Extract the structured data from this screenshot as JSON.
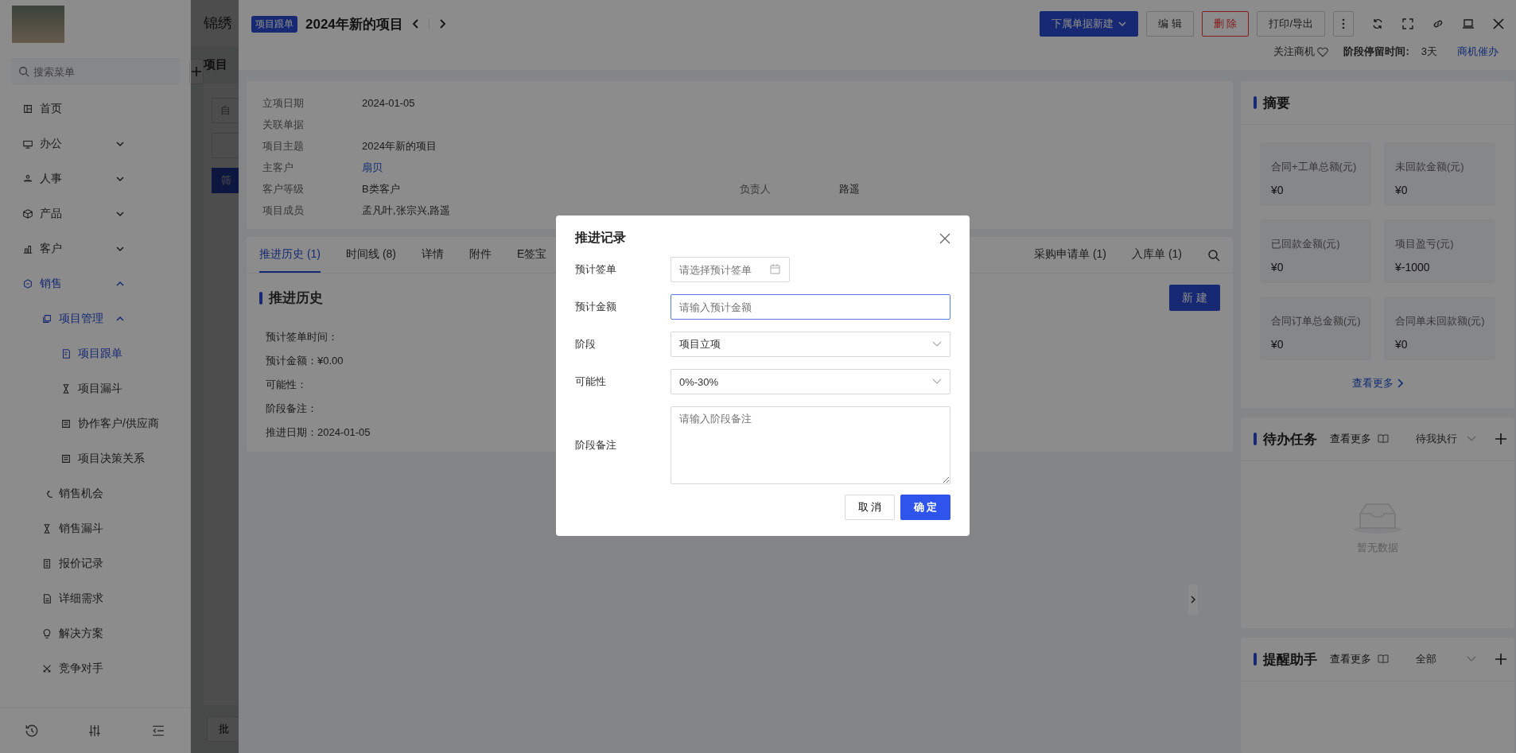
{
  "sidebar": {
    "search": {
      "placeholder": "搜索菜单"
    },
    "items": [
      {
        "label": "首页",
        "selected": false
      },
      {
        "label": "办公",
        "expanded": false
      },
      {
        "label": "人事",
        "expanded": false
      },
      {
        "label": "产品",
        "expanded": false
      },
      {
        "label": "客户",
        "expanded": false
      },
      {
        "label": "销售",
        "expanded": true,
        "children": [
          {
            "label": "项目管理",
            "expanded": true,
            "children": [
              {
                "label": "项目跟单",
                "selected": true
              },
              {
                "label": "项目漏斗",
                "selected": false
              },
              {
                "label": "协作客户/供应商",
                "selected": false
              },
              {
                "label": "项目决策关系",
                "selected": false
              }
            ]
          },
          {
            "label": "销售机会",
            "selected": false
          },
          {
            "label": "销售漏斗",
            "selected": false
          },
          {
            "label": "报价记录",
            "selected": false
          },
          {
            "label": "详细需求",
            "selected": false
          },
          {
            "label": "解决方案",
            "selected": false
          },
          {
            "label": "竞争对手",
            "selected": false
          }
        ]
      }
    ]
  },
  "background_page": {
    "title": "锦绣",
    "section_title": "项目",
    "filter_input": "自",
    "filter_button": "筛",
    "batch_button": "批"
  },
  "drawer": {
    "badge": "项目跟单",
    "title": "2024年新的项目",
    "actions": [
      {
        "label": "下属单据新建",
        "kind": "primary-dropdown"
      },
      {
        "label": "编 辑",
        "kind": "default"
      },
      {
        "label": "删 除",
        "kind": "danger"
      },
      {
        "label": "打印/导出",
        "kind": "default"
      }
    ],
    "follow_label": "关注商机",
    "stay_label": "阶段停留时间:",
    "stay_value": "3天",
    "urge_link": "商机催办"
  },
  "info": {
    "rows": [
      {
        "label": "立项日期",
        "value": "2024-01-05",
        "kind": "text"
      },
      {
        "label": "关联单据"
      },
      {
        "label": "项目主题",
        "value": "2024年新的项目",
        "kind": "text"
      },
      {
        "label": "主客户",
        "value": "扇贝",
        "kind": "link"
      },
      {
        "label": "客户等级",
        "value": "B类客户",
        "kind": "text",
        "extra_label": "负责人",
        "extra_value": "路遥"
      },
      {
        "label": "项目成员",
        "value": "孟凡叶,张宗兴,路遥",
        "kind": "text"
      }
    ]
  },
  "tabs": {
    "left": [
      {
        "label": "推进历史 (1)",
        "selected": true
      },
      {
        "label": "时间线 (8)",
        "selected": false
      },
      {
        "label": "详情",
        "selected": false
      },
      {
        "label": "附件",
        "selected": false
      },
      {
        "label": "E签宝",
        "selected": false
      }
    ],
    "right": [
      {
        "label": "采购申请单 (1)",
        "selected": false
      },
      {
        "label": "入库单 (1)",
        "selected": false
      }
    ]
  },
  "record": {
    "title": "推进历史",
    "new_button": "新 建",
    "lines": [
      "预计签单时间：",
      "预计金额：¥0.00",
      "可能性：",
      "阶段备注：",
      "推进日期：2024-01-05"
    ]
  },
  "summary": {
    "title": "摘要",
    "stats": [
      {
        "label": "合同+工单总额(元)",
        "value": "¥0"
      },
      {
        "label": "未回款金额(元)",
        "value": "¥0"
      },
      {
        "label": "已回款金额(元)",
        "value": "¥0"
      },
      {
        "label": "项目盈亏(元)",
        "value": "¥-1000"
      },
      {
        "label": "合同订单总金额(元)",
        "value": "¥0"
      },
      {
        "label": "合同单未回款额(元)",
        "value": "¥0"
      }
    ],
    "more_link": "查看更多"
  },
  "todo": {
    "title": "待办任务",
    "more": "查看更多",
    "filter": "待我执行",
    "empty": "暂无数据"
  },
  "reminder": {
    "title": "提醒助手",
    "more": "查看更多",
    "filter": "全部"
  },
  "modal": {
    "title": "推进记录",
    "fields": [
      {
        "label": "预计签单",
        "kind": "date",
        "placeholder": "请选择预计签单",
        "focused": false
      },
      {
        "label": "预计金额",
        "kind": "input",
        "placeholder": "请输入预计金额",
        "focused": true
      },
      {
        "label": "阶段",
        "kind": "select",
        "value": "项目立项",
        "focused": false
      },
      {
        "label": "可能性",
        "kind": "select",
        "value": "0%-30%",
        "focused": false
      },
      {
        "label": "阶段备注",
        "kind": "textarea",
        "placeholder": "请输入阶段备注",
        "focused": false
      }
    ],
    "cancel": "取 消",
    "confirm": "确 定"
  }
}
